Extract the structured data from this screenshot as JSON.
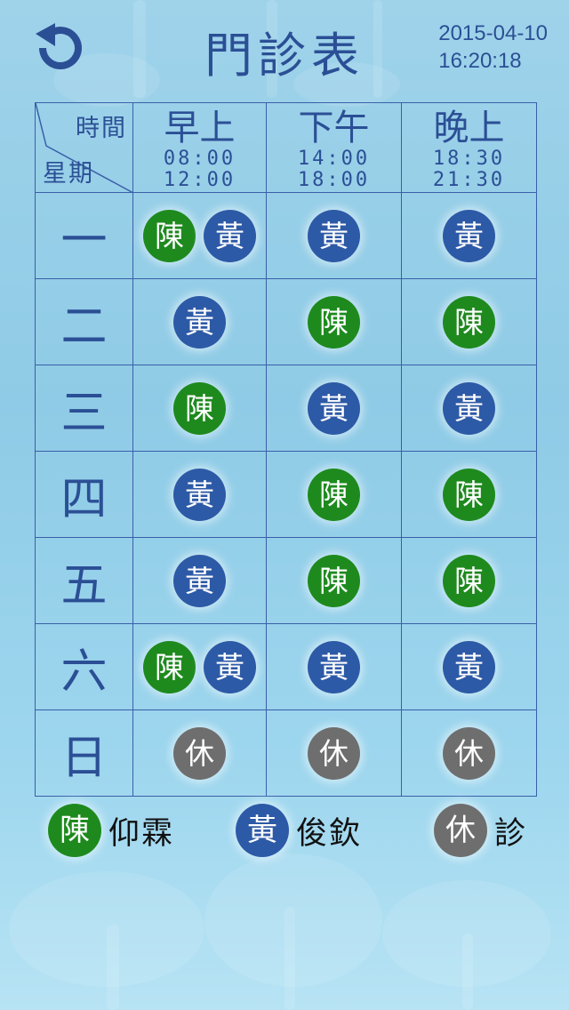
{
  "header": {
    "title": "門診表",
    "date": "2015-04-10",
    "time": "16:20:18",
    "back_icon": "refresh-back-icon"
  },
  "table": {
    "corner": {
      "time_label": "時間",
      "day_label": "星期"
    },
    "slots": [
      {
        "name": "早上",
        "start": "08:00",
        "end": "12:00"
      },
      {
        "name": "下午",
        "start": "14:00",
        "end": "18:00"
      },
      {
        "name": "晚上",
        "start": "18:30",
        "end": "21:30"
      }
    ],
    "days": [
      "一",
      "二",
      "三",
      "四",
      "五",
      "六",
      "日"
    ]
  },
  "badge_labels": {
    "chen": "陳",
    "huang": "黃",
    "rest": "休"
  },
  "colors": {
    "chen": "#1e8a1e",
    "huang": "#2d5aa6",
    "rest": "#6e6e6e",
    "text": "#2b4f95"
  },
  "legend": [
    {
      "badge": "陳",
      "label": "仰霖"
    },
    {
      "badge": "黃",
      "label": "俊欽"
    },
    {
      "badge": "休",
      "label": "診"
    }
  ]
}
